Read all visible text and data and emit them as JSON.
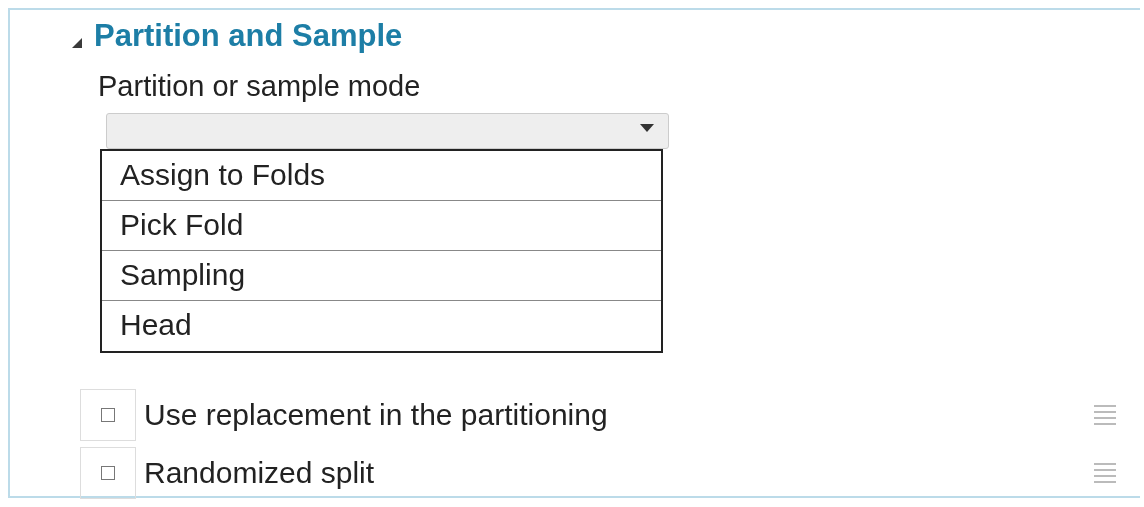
{
  "section": {
    "title": "Partition and Sample",
    "expanded": true
  },
  "mode_field": {
    "label": "Partition or sample mode",
    "open": true,
    "options": [
      {
        "label": "Assign to Folds",
        "selected": false
      },
      {
        "label": "Pick Fold",
        "selected": false
      },
      {
        "label": "Sampling",
        "selected": false
      },
      {
        "label": "Head",
        "selected": false
      }
    ]
  },
  "options": [
    {
      "label": "Use replacement in the partitioning",
      "checked": false
    },
    {
      "label": "Randomized split",
      "checked": false
    }
  ]
}
